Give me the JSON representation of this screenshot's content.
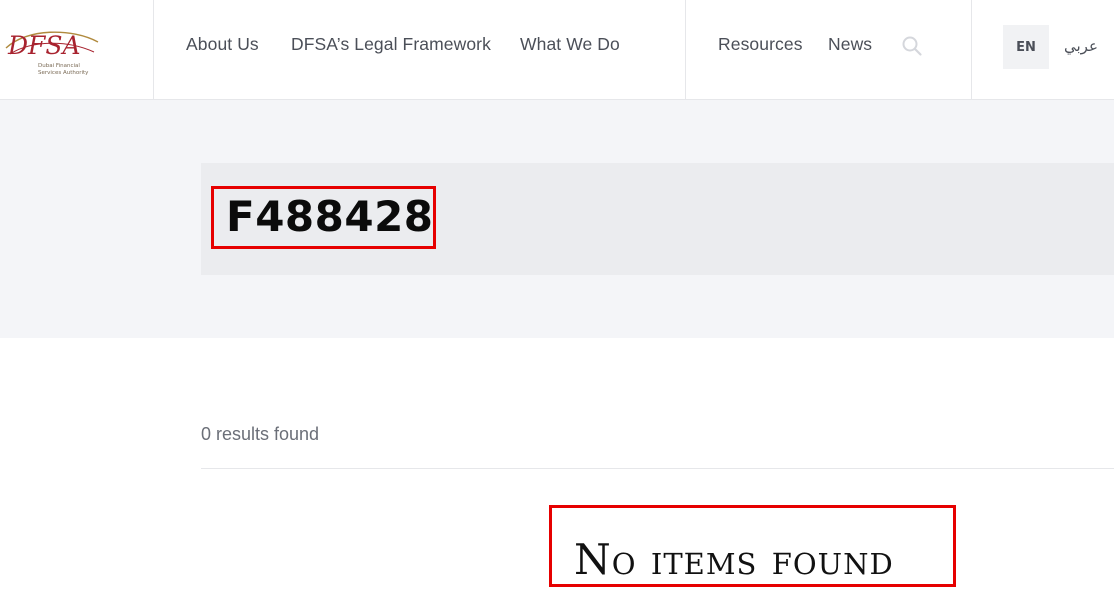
{
  "header": {
    "logo": {
      "mark": "DFSA",
      "tagline_line1": "Dubai Financial",
      "tagline_line2": "Services Authority"
    },
    "nav": {
      "about": "About Us",
      "legal": "DFSA’s Legal Framework",
      "what_we_do": "What We Do",
      "resources": "Resources",
      "news": "News"
    },
    "search_icon": "search-icon",
    "lang": {
      "en": "EN",
      "ar": "عربي"
    }
  },
  "hero": {
    "query": "F488428"
  },
  "results": {
    "count_text": "0 results found",
    "empty_text": "No items found"
  },
  "colors": {
    "brand_red": "#a8232f",
    "brand_gold": "#b08a3e",
    "highlight": "#e60000",
    "hero_bg": "#f4f5f8",
    "hero_box_bg": "#ebecef"
  }
}
